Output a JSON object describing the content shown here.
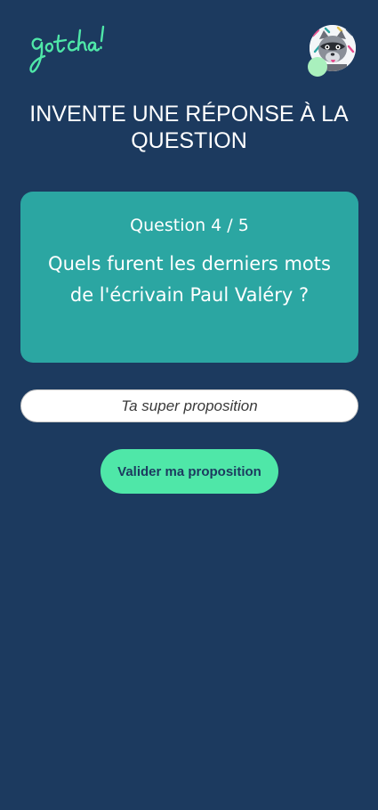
{
  "header": {
    "logo_text": "gotcha!",
    "logo_color": "#4fe7a8",
    "avatar_icon": "raccoon-avatar-icon",
    "status_dot_color": "#a9f0bd"
  },
  "page": {
    "title": "INVENTE UNE RÉPONSE À LA QUESTION",
    "background_color": "#1c3a5f"
  },
  "question": {
    "counter": "Question 4 / 5",
    "text": "Quels furent les derniers mots de l'écrivain Paul Valéry ?",
    "card_color": "#2ba6a2"
  },
  "answer": {
    "placeholder": "Ta super proposition",
    "value": ""
  },
  "actions": {
    "submit_label": "Valider ma proposition",
    "submit_color": "#4fe7a8"
  }
}
